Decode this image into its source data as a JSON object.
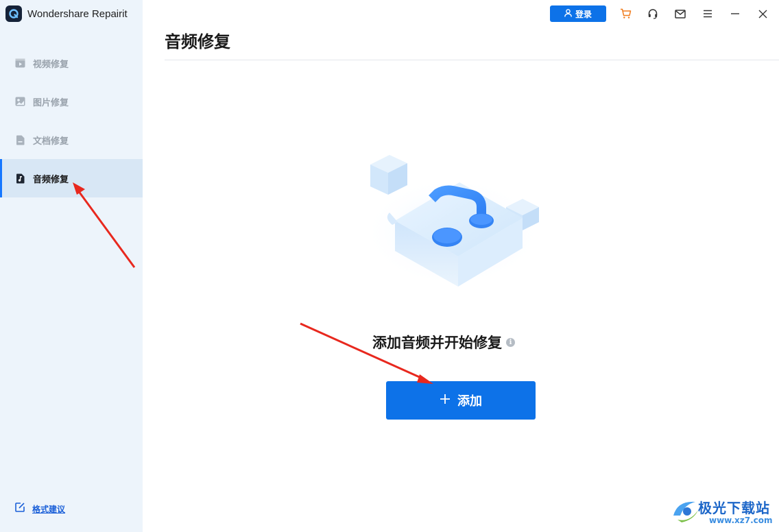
{
  "app": {
    "title": "Wondershare Repairit"
  },
  "sidebar": {
    "items": [
      {
        "label": "视频修复",
        "icon": "video-icon",
        "active": false
      },
      {
        "label": "图片修复",
        "icon": "image-icon",
        "active": false
      },
      {
        "label": "文档修复",
        "icon": "document-icon",
        "active": false
      },
      {
        "label": "音频修复",
        "icon": "music-note-icon",
        "active": true
      }
    ],
    "feedback_label": "格式建议"
  },
  "topbar": {
    "login_label": "登录",
    "icons": [
      "cart-icon",
      "headset-icon",
      "mail-icon",
      "menu-icon",
      "minimize-icon",
      "close-icon"
    ]
  },
  "main": {
    "title": "音频修复",
    "prompt": "添加音频并开始修复",
    "add_label": "添加",
    "add_icon": "plus-icon"
  },
  "watermark": {
    "name": "极光下载站",
    "url": "www.xz7.com"
  },
  "colors": {
    "accent": "#0d72e8",
    "sidebar_bg": "#edf4fb",
    "active_bg": "#d8e7f5",
    "annotation": "#e8281e",
    "cart": "#f07a1a"
  }
}
